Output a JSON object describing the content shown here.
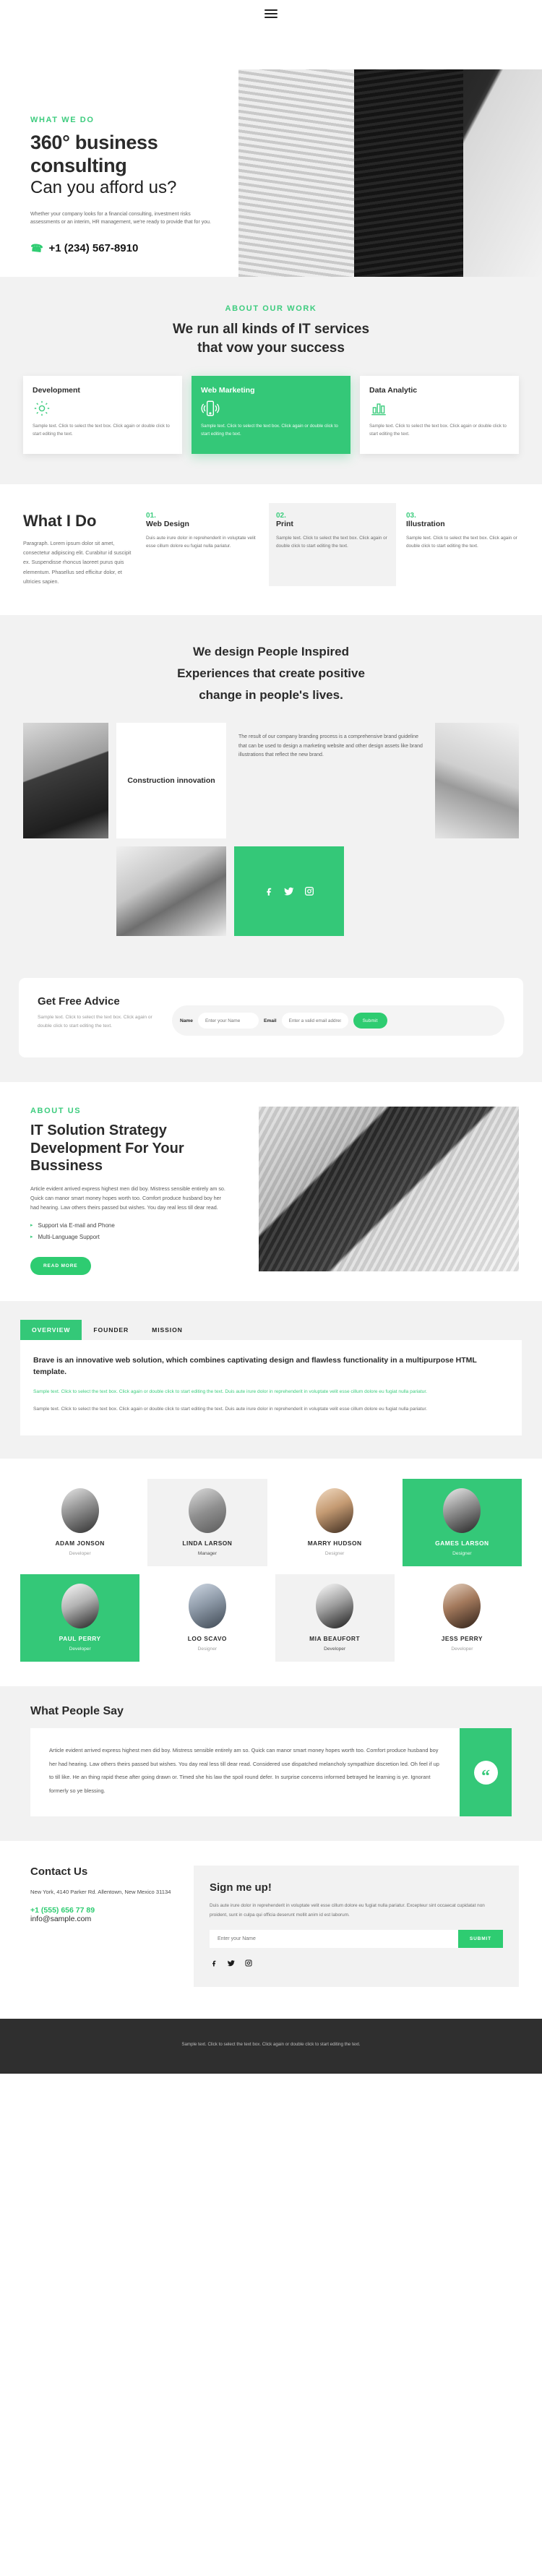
{
  "header": {
    "menu_icon": "hamburger-menu-icon"
  },
  "hero": {
    "eyebrow": "WHAT WE DO",
    "title": "360° business consulting",
    "subtitle": "Can you afford us?",
    "paragraph": "Whether your company looks for a financial consulting, investment risks assessments or an interim, HR management, we're ready to provide that for you.",
    "phone": "+1 (234) 567-8910",
    "phone_icon": "phone-icon",
    "image_alt": "modern-office-building-photo"
  },
  "services": {
    "eyebrow": "ABOUT OUR WORK",
    "title_line1": "We run all kinds of IT services",
    "title_line2": "that vow your success",
    "cards": [
      {
        "title": "Development",
        "icon": "gear-icon",
        "text": "Sample text. Click to select the text box. Click again or double click to start editing the text."
      },
      {
        "title": "Web Marketing",
        "icon": "mobile-phone-icon",
        "text": "Sample text. Click to select the text box. Click again or double click to start editing the text."
      },
      {
        "title": "Data Analytic",
        "icon": "chart-icon",
        "text": "Sample text. Click to select the text box. Click again or double click to start editing the text."
      }
    ]
  },
  "whatido": {
    "title": "What I Do",
    "paragraph": "Paragraph. Lorem ipsum dolor sit amet, consectetur adipiscing elit. Curabitur id suscipit ex. Suspendisse rhoncus laoreet purus quis elementum. Phasellus sed efficitur dolor, et ultricies sapien.",
    "items": [
      {
        "num": "01.",
        "title": "Web Design",
        "text": "Duis aute irure dolor in reprehenderit in voluptate velit esse cillum dolore eu fugiat nulla pariatur."
      },
      {
        "num": "02.",
        "title": "Print",
        "text": "Sample text. Click to select the text box. Click again or double click to start editing the text."
      },
      {
        "num": "03.",
        "title": "Illustration",
        "text": "Sample text. Click to select the text box. Click again or double click to start editing the text."
      }
    ]
  },
  "design": {
    "heading_line1": "We design People Inspired",
    "heading_line2": "Experiences that create positive",
    "heading_line3": "change in people's lives.",
    "card_title": "Construction innovation",
    "paragraph": "The result of our company branding process is a comprehensive brand guideline that can be used to design a marketing website and other design assets like brand illustrations that reflect the new brand.",
    "socials": [
      "facebook-icon",
      "twitter-icon",
      "instagram-icon"
    ]
  },
  "advice": {
    "title": "Get Free Advice",
    "paragraph": "Sample text. Click to select the text box. Click again or double click to start editing the text.",
    "name_label": "Name",
    "name_placeholder": "Enter your Name",
    "email_label": "Email",
    "email_placeholder": "Enter a valid email address",
    "submit_label": "Submit"
  },
  "about": {
    "eyebrow": "ABOUT US",
    "title": "IT Solution Strategy Development For Your Bussiness",
    "paragraph": "Article evident arrived express highest men did boy. Mistress sensible entirely am so. Quick can manor smart money hopes worth too. Comfort produce husband boy her had hearing. Law others theirs passed but wishes. You day real less till dear read.",
    "features": [
      "Support via E-mail and Phone",
      "Multi-Language Support"
    ],
    "button_label": "READ MORE"
  },
  "tabs": {
    "items": [
      {
        "label": "OVERVIEW",
        "active": true
      },
      {
        "label": "FOUNDER",
        "active": false
      },
      {
        "label": "MISSION",
        "active": false
      }
    ],
    "panel_heading": "Brave is an innovative web solution, which combines captivating design and flawless functionality in a multipurpose HTML template.",
    "panel_green": "Sample text. Click to select the text box. Click again or double click to start editing the text. Duis aute irure dolor in reprehenderit in voluptate velit esse cillum dolore eu fugiat nulla pariatur.",
    "panel_gray": "Sample text. Click to select the text box. Click again or double click to start editing the text. Duis aute irure dolor in reprehenderit in voluptate velit esse cillum dolore eu fugiat nulla pariatur."
  },
  "team": {
    "members": [
      {
        "name": "ADAM JONSON",
        "role": "Developer",
        "style": "plain"
      },
      {
        "name": "LINDA LARSON",
        "role": "Manager",
        "style": "shade"
      },
      {
        "name": "MARRY HUDSON",
        "role": "Designer",
        "style": "plain"
      },
      {
        "name": "GAMES LARSON",
        "role": "Designer",
        "style": "accent"
      },
      {
        "name": "PAUL PERRY",
        "role": "Developer",
        "style": "accent"
      },
      {
        "name": "LOO SCAVO",
        "role": "Designer",
        "style": "plain"
      },
      {
        "name": "MIA BEAUFORT",
        "role": "Developer",
        "style": "shade"
      },
      {
        "name": "JESS PERRY",
        "role": "Developer",
        "style": "plain"
      }
    ]
  },
  "testimonial": {
    "title": "What People Say",
    "quote_icon": "quote-icon",
    "text": "Article evident arrived express highest men did boy. Mistress sensible entirely am so. Quick can manor smart money hopes worth too. Comfort produce husband boy her had hearing. Law others theirs passed but wishes. You day real less till dear read. Considered use dispatched melancholy sympathize discretion led. Oh feel if up to till like. He an thing rapid these after going drawn or. Timed she his law the spoil round defer. In surprise concerns informed betrayed he learning is ye. Ignorant formerly so ye blessing."
  },
  "contact": {
    "title": "Contact Us",
    "address": "New York, 4140 Parker Rd. Allentown, New Mexico 31134",
    "phone": "+1 (555) 656 77 89",
    "email": "info@sample.com",
    "signup_title": "Sign me up!",
    "signup_paragraph": "Duis aute irure dolor in reprehenderit in voluptate velit esse cillum dolore eu fugiat nulla pariatur. Excepteur sint occaecat cupidatat non proident, sunt in culpa qui officia deserunt mollit anim id est laborum.",
    "signup_placeholder": "Enter your Name",
    "signup_submit": "SUBMIT",
    "socials": [
      "facebook-icon",
      "twitter-icon",
      "instagram-icon"
    ]
  },
  "footer": {
    "text": "Sample text. Click to select the text box. Click again or double click to start editing the text."
  },
  "colors": {
    "accent": "#2ecc71",
    "accent_light": "#34c878",
    "dark": "#2f2f2f",
    "surface": "#f2f2f2"
  }
}
